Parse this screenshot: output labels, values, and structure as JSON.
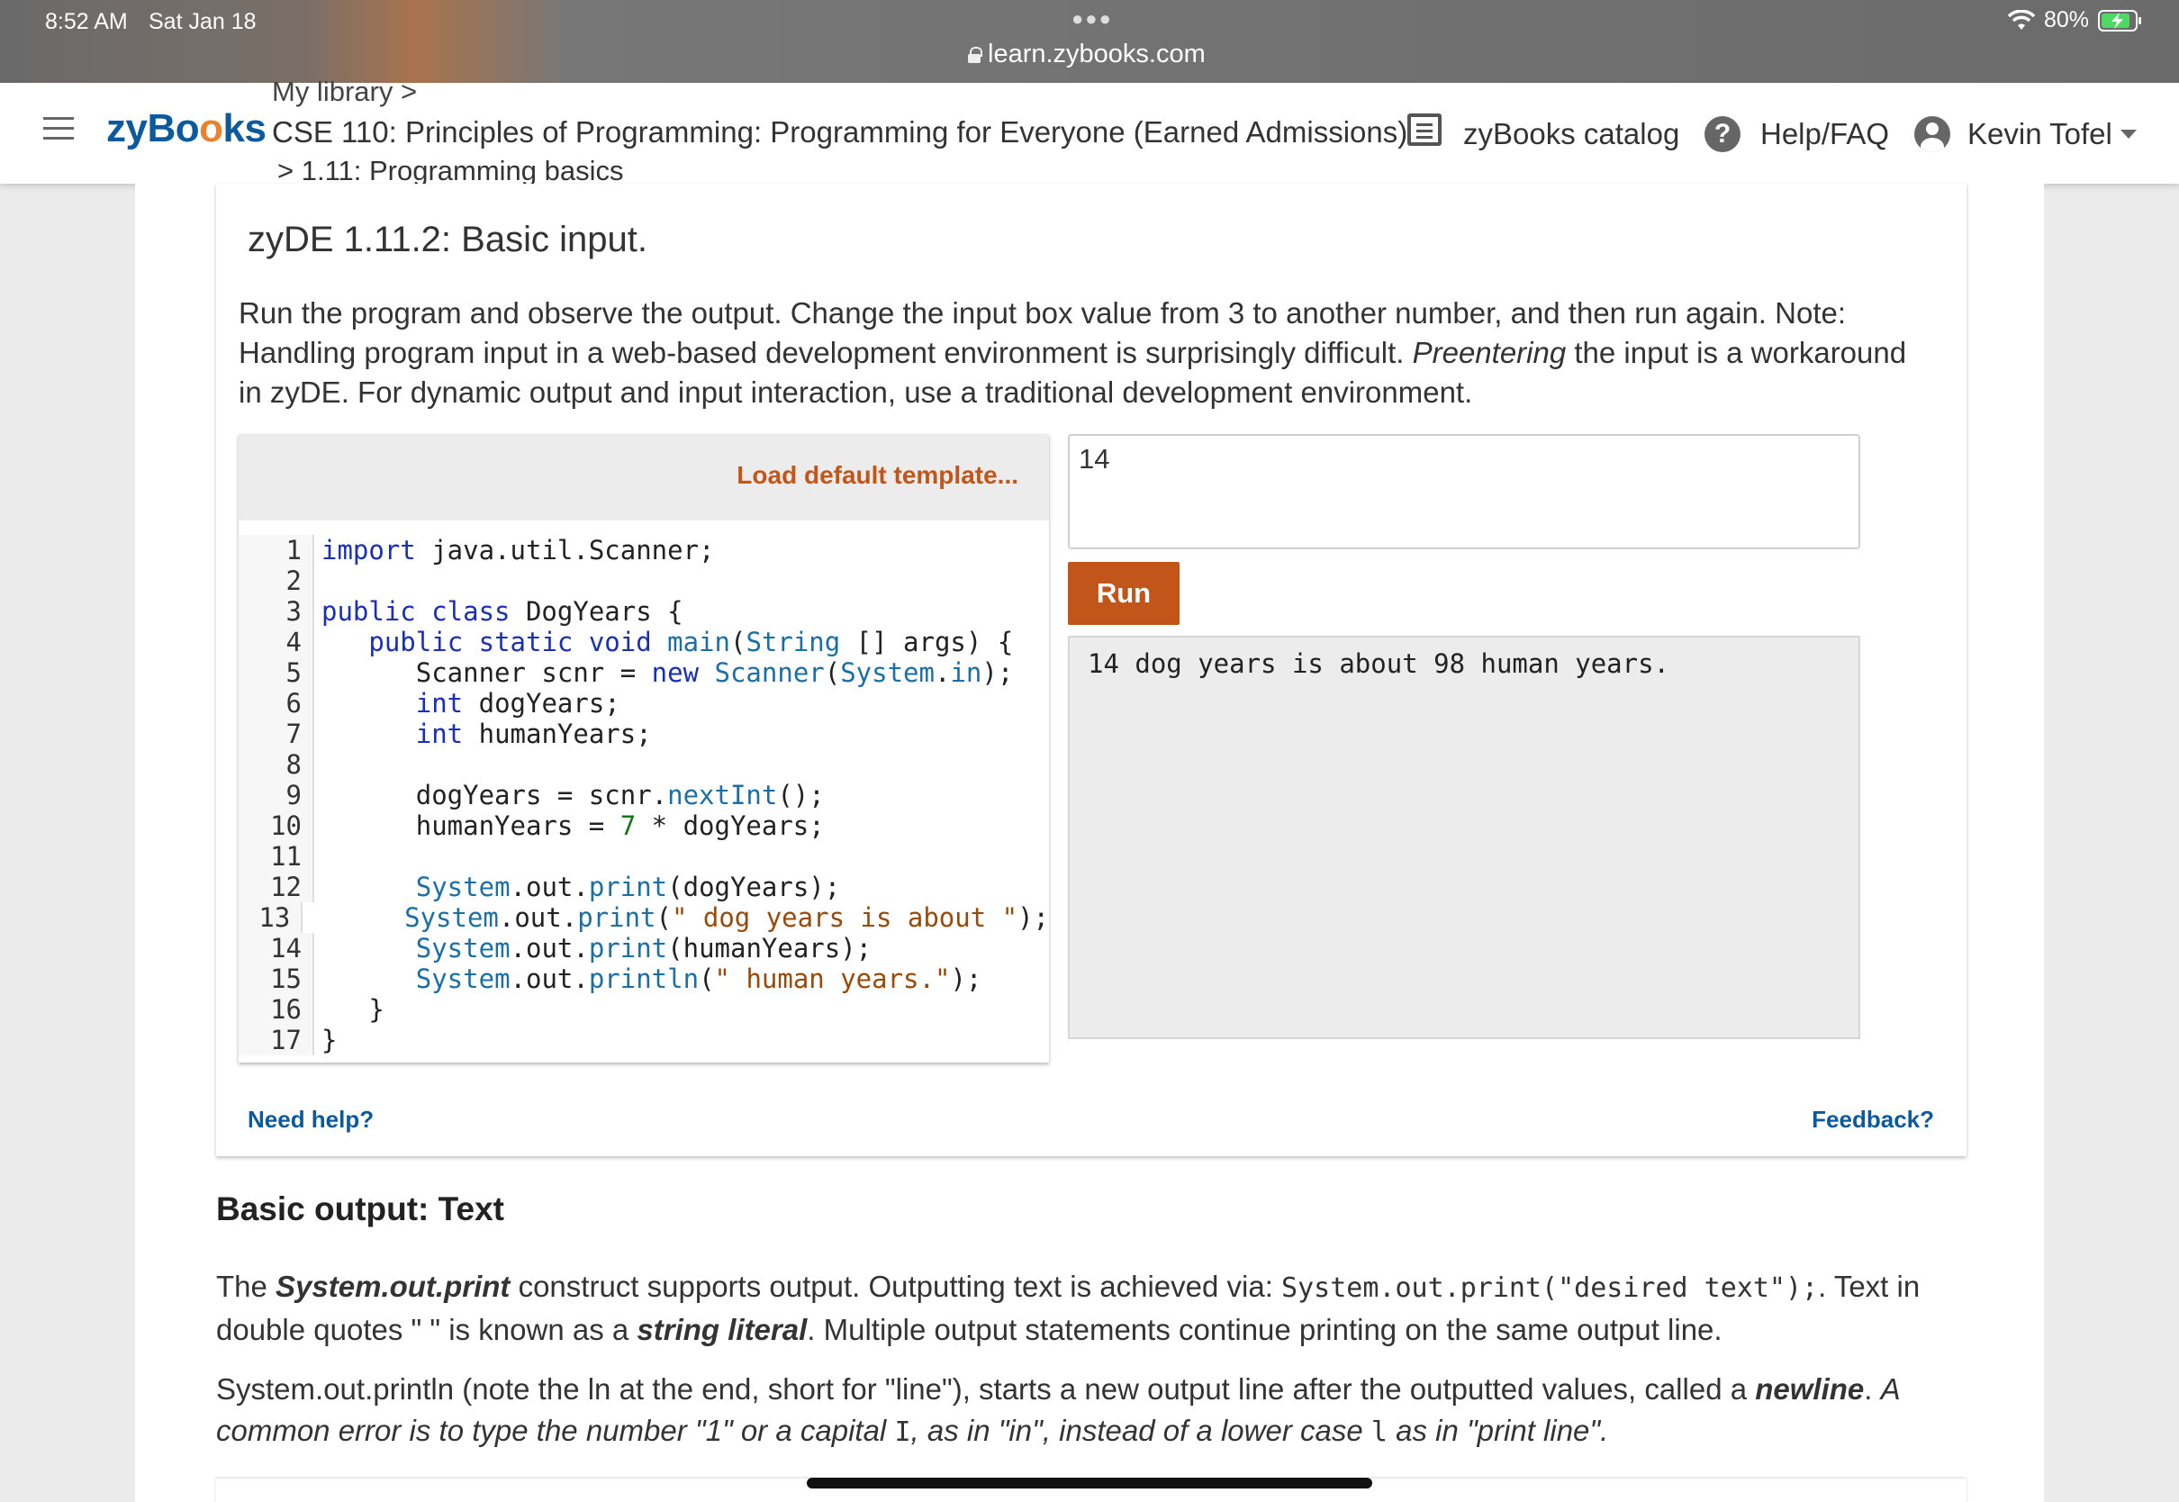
{
  "status_bar": {
    "time": "8:52 AM",
    "date": "Sat Jan 18",
    "url": "learn.zybooks.com",
    "battery": "80%",
    "battery_level": 0.8
  },
  "nav": {
    "logo_prefix": "zyB",
    "logo_o1": "o",
    "logo_o2": "o",
    "logo_suffix": "ks",
    "breadcrumb_library": "My library >",
    "breadcrumb_course": "CSE 110: Principles of Programming: Programming for Everyone (Earned Admissions) home",
    "breadcrumb_section": "> 1.11: Programming basics",
    "catalog": "zyBooks catalog",
    "help": "Help/FAQ",
    "user": "Kevin Tofel"
  },
  "zyde": {
    "title": "zyDE 1.11.2: Basic input.",
    "desc_part1": "Run the program and observe the output. Change the input box value from 3 to another number, and then run again. Note: Handling program input in a web-based development environment is surprisingly difficult. ",
    "desc_italic": "Preentering",
    "desc_part2": " the input is a workaround in zyDE. For dynamic output and input interaction, use a traditional development environment.",
    "load_template": "Load default template...",
    "input_value": "14",
    "run_label": "Run",
    "output": "14 dog years is about 98 human years.",
    "need_help": "Need help?",
    "feedback": "Feedback?",
    "line_numbers": [
      "1",
      "2",
      "3",
      "4",
      "5",
      "6",
      "7",
      "8",
      "9",
      "10",
      "11",
      "12",
      "13",
      "14",
      "15",
      "16",
      "17"
    ]
  },
  "section": {
    "title": "Basic output: Text",
    "p1_a": "The ",
    "p1_term": "System.out.print",
    "p1_b": " construct supports output. Outputting text is achieved via: ",
    "p1_code": "System.out.print(\"desired text\");",
    "p1_c": ". Text in double quotes \" \" is known as a ",
    "p1_term2": "string literal",
    "p1_d": ". Multiple output statements continue printing on the same output line.",
    "p2_a": "System.out.println (note the ln at the end, short for \"line\"), starts a new output line after the outputted values, called a ",
    "p2_term": "newline",
    "p2_b": ". ",
    "p2_i1": "A common error is to type the number \"1\" or a capital ",
    "p2_code1": "I",
    "p2_i2": ", as in \"in\", instead of a lower case ",
    "p2_code2": "l",
    "p2_i3": " as in \"print line\"."
  }
}
